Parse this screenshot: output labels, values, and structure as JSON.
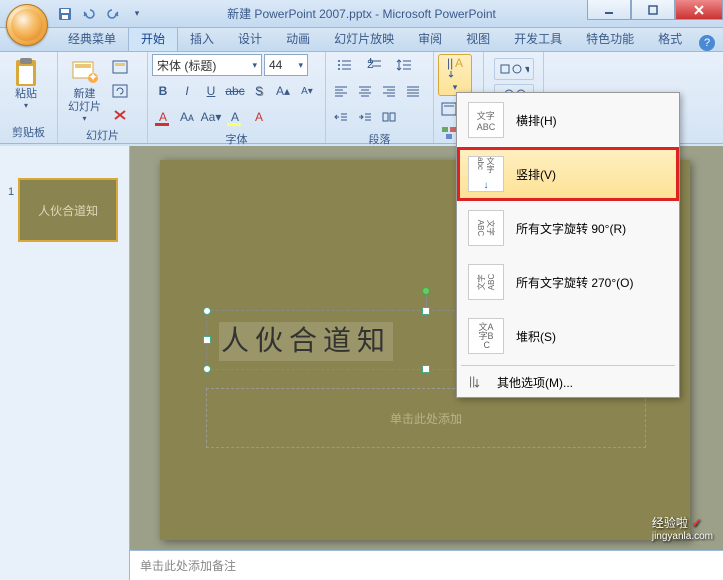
{
  "window": {
    "title": "新建 PowerPoint 2007.pptx - Microsoft PowerPoint"
  },
  "tabs": {
    "classic": "经典菜单",
    "home": "开始",
    "insert": "插入",
    "design": "设计",
    "animation": "动画",
    "slideshow": "幻灯片放映",
    "review": "审阅",
    "view": "视图",
    "developer": "开发工具",
    "addins": "特色功能",
    "format": "格式"
  },
  "ribbon": {
    "clipboard": {
      "label": "剪贴板",
      "paste": "粘贴"
    },
    "slides": {
      "label": "幻灯片",
      "new_slide": "新建\n幻灯片"
    },
    "font": {
      "label": "字体",
      "name": "宋体 (标题)",
      "size": "44"
    },
    "paragraph": {
      "label": "段落"
    }
  },
  "text_direction_menu": {
    "horizontal": {
      "icon_text": "文字\nABC",
      "label": "横排(H)"
    },
    "vertical": {
      "icon_text": "文字→",
      "label": "竖排(V)"
    },
    "rotate90": {
      "icon_text": "文字\nABC",
      "label": "所有文字旋转 90°(R)"
    },
    "rotate270": {
      "icon_text": "文字\nABC",
      "label": "所有文字旋转 270°(O)"
    },
    "stacked": {
      "icon_text": "文A\n字B\n  C",
      "label": "堆积(S)"
    },
    "more": "其他选项(M)..."
  },
  "slide": {
    "title_text": "人伙合道知",
    "subtitle_placeholder": "单击此处添加",
    "thumb_text": "人伙合道知"
  },
  "notes": {
    "placeholder": "单击此处添加备注"
  },
  "watermark": {
    "brand": "经验啦",
    "url": "jingyanla.com"
  }
}
